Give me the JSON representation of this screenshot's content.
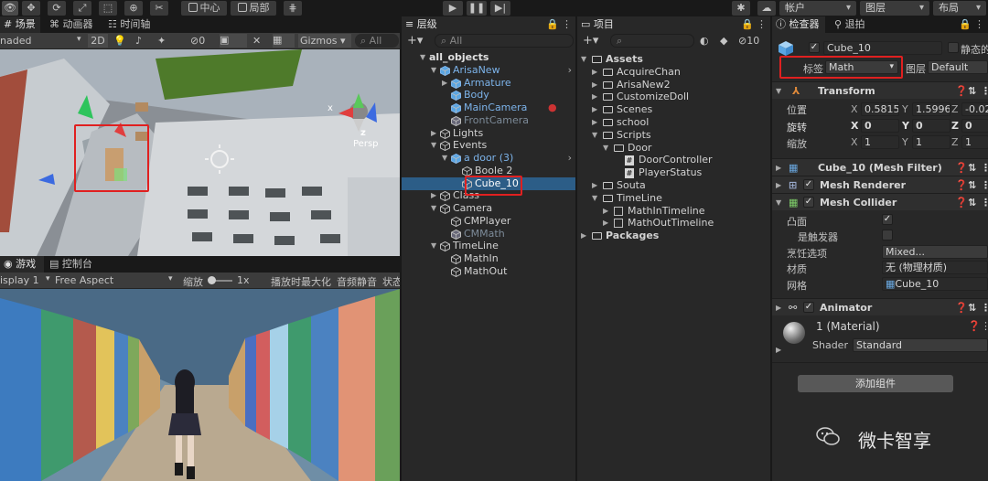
{
  "toolbar": {
    "pivot": "中心",
    "space": "局部",
    "account": "帐户",
    "layers": "图层",
    "layout": "布局"
  },
  "scene": {
    "tabs": [
      "场景",
      "动画器",
      "时间轴"
    ],
    "shading": "naded",
    "mode_2d": "2D",
    "gizmo_count": "0",
    "gizmos": "Gizmos",
    "search_placeholder": "All",
    "persp": "Persp",
    "axis_x": "x",
    "axis_z": "z"
  },
  "game": {
    "tabs": [
      "游戏",
      "控制台"
    ],
    "display": "isplay 1",
    "aspect": "Free Aspect",
    "scale_label": "缩放",
    "scale_value": "1x",
    "maximize": "播放时最大化",
    "mute": "音频静音",
    "status": "状态"
  },
  "hierarchy": {
    "tab": "层级",
    "search_placeholder": "All",
    "rows": [
      {
        "label": "all_objects",
        "depth": 0,
        "arrow": "▼",
        "icon": "none",
        "style": "bold"
      },
      {
        "label": "ArisaNew",
        "depth": 1,
        "arrow": "▼",
        "icon": "cube",
        "style": "blue"
      },
      {
        "label": "Armature",
        "depth": 2,
        "arrow": "▶",
        "icon": "cube",
        "style": "blue"
      },
      {
        "label": "Body",
        "depth": 2,
        "arrow": "",
        "icon": "cube",
        "style": "blue"
      },
      {
        "label": "MainCamera",
        "depth": 2,
        "arrow": "",
        "icon": "cube",
        "style": "blue"
      },
      {
        "label": "FrontCamera",
        "depth": 2,
        "arrow": "",
        "icon": "cube",
        "style": "dim"
      },
      {
        "label": "Lights",
        "depth": 1,
        "arrow": "▶",
        "icon": "cube",
        "style": "normal"
      },
      {
        "label": "Events",
        "depth": 1,
        "arrow": "▼",
        "icon": "cube",
        "style": "normal"
      },
      {
        "label": "a door (3)",
        "depth": 2,
        "arrow": "▼",
        "icon": "cube",
        "style": "blue"
      },
      {
        "label": "Boole 2",
        "depth": 3,
        "arrow": "",
        "icon": "cube",
        "style": "normal"
      },
      {
        "label": "Cube_10",
        "depth": 3,
        "arrow": "",
        "icon": "cube",
        "style": "selected"
      },
      {
        "label": "Class",
        "depth": 1,
        "arrow": "▶",
        "icon": "cube",
        "style": "normal"
      },
      {
        "label": "Camera",
        "depth": 1,
        "arrow": "▼",
        "icon": "cube",
        "style": "normal"
      },
      {
        "label": "CMPlayer",
        "depth": 2,
        "arrow": "",
        "icon": "cube",
        "style": "normal"
      },
      {
        "label": "CMMath",
        "depth": 2,
        "arrow": "",
        "icon": "cube",
        "style": "dim"
      },
      {
        "label": "TimeLine",
        "depth": 1,
        "arrow": "▼",
        "icon": "cube",
        "style": "normal"
      },
      {
        "label": "MathIn",
        "depth": 2,
        "arrow": "",
        "icon": "cube",
        "style": "normal"
      },
      {
        "label": "MathOut",
        "depth": 2,
        "arrow": "",
        "icon": "cube",
        "style": "normal"
      }
    ]
  },
  "project": {
    "tab": "项目",
    "hidden_count": "10",
    "rows": [
      {
        "label": "Assets",
        "depth": 0,
        "arrow": "▼",
        "icon": "folder",
        "bold": true
      },
      {
        "label": "AcquireChan",
        "depth": 1,
        "arrow": "▶",
        "icon": "folder"
      },
      {
        "label": "ArisaNew2",
        "depth": 1,
        "arrow": "▶",
        "icon": "folder"
      },
      {
        "label": "CustomizeDoll",
        "depth": 1,
        "arrow": "▶",
        "icon": "folder"
      },
      {
        "label": "Scenes",
        "depth": 1,
        "arrow": "▶",
        "icon": "folder"
      },
      {
        "label": "school",
        "depth": 1,
        "arrow": "▶",
        "icon": "folder"
      },
      {
        "label": "Scripts",
        "depth": 1,
        "arrow": "▼",
        "icon": "folder"
      },
      {
        "label": "Door",
        "depth": 2,
        "arrow": "▼",
        "icon": "folder"
      },
      {
        "label": "DoorController",
        "depth": 3,
        "arrow": "",
        "icon": "script"
      },
      {
        "label": "PlayerStatus",
        "depth": 3,
        "arrow": "",
        "icon": "script"
      },
      {
        "label": "Souta",
        "depth": 1,
        "arrow": "▶",
        "icon": "folder"
      },
      {
        "label": "TimeLine",
        "depth": 1,
        "arrow": "▼",
        "icon": "folder"
      },
      {
        "label": "MathInTimeline",
        "depth": 2,
        "arrow": "▶",
        "icon": "timeline"
      },
      {
        "label": "MathOutTimeline",
        "depth": 2,
        "arrow": "▶",
        "icon": "timeline"
      },
      {
        "label": "Packages",
        "depth": 0,
        "arrow": "▶",
        "icon": "folder",
        "bold": true
      }
    ]
  },
  "inspector": {
    "tabs": [
      "检查器",
      "退拍"
    ],
    "object_name": "Cube_10",
    "static_label": "静态的",
    "tag_label": "标签",
    "tag_value": "Math",
    "layer_label": "图层",
    "layer_value": "Default",
    "transform": {
      "title": "Transform",
      "position_label": "位置",
      "rotation_label": "旋转",
      "scale_label": "缩放",
      "pos": [
        "0.5815",
        "1.5996",
        "-0.02"
      ],
      "rot": [
        "0",
        "0",
        "0"
      ],
      "scl": [
        "1",
        "1",
        "1"
      ],
      "axes": [
        "X",
        "Y",
        "Z"
      ]
    },
    "mesh_filter": "Cube_10 (Mesh Filter)",
    "mesh_renderer": "Mesh Renderer",
    "mesh_collider": {
      "title": "Mesh Collider",
      "convex_label": "凸面",
      "trigger_label": "是触发器",
      "cooking_label": "烹饪选项",
      "cooking_value": "Mixed...",
      "material_label": "材质",
      "material_value": "无 (物理材质)",
      "mesh_label": "网格",
      "mesh_value": "Cube_10"
    },
    "animator": "Animator",
    "material": {
      "name": "1 (Material)",
      "shader_label": "Shader",
      "shader_value": "Standard"
    },
    "add_component": "添加组件"
  },
  "watermark": "微卡智享"
}
